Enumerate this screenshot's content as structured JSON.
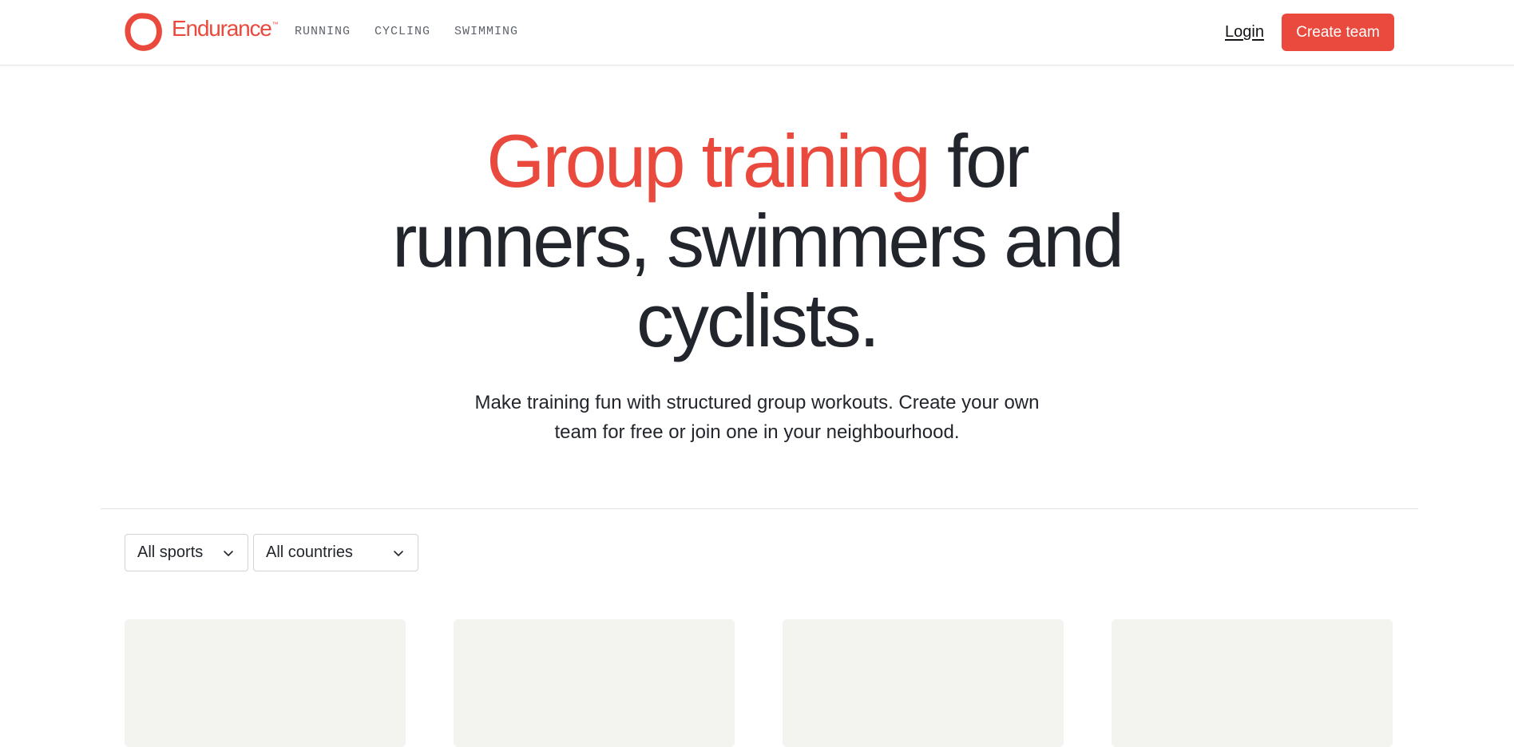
{
  "brand": {
    "name": "Endurance",
    "trademark": "™",
    "color": "#ea4a3d"
  },
  "nav": {
    "items": [
      {
        "label": "RUNNING"
      },
      {
        "label": "CYCLING"
      },
      {
        "label": "SWIMMING"
      }
    ]
  },
  "header": {
    "login_label": "Login",
    "create_team_label": "Create team"
  },
  "hero": {
    "title_accent": "Group training",
    "title_rest_line1": " for",
    "title_line2": "runners, swimmers and",
    "title_line3": "cyclists.",
    "subtitle_line1": "Make training fun with structured group workouts. Create your own",
    "subtitle_line2": "team for free or join one in your neighbourhood."
  },
  "filters": {
    "sport": {
      "selected": "All sports",
      "icon": "chevron-down-icon"
    },
    "country": {
      "selected": "All countries",
      "icon": "chevron-down-icon"
    }
  },
  "cards": [
    {
      "state": "loading"
    },
    {
      "state": "loading"
    },
    {
      "state": "loading"
    },
    {
      "state": "loading"
    }
  ],
  "colors": {
    "accent": "#ea4a3d",
    "text": "#22262c",
    "card_placeholder": "#f3f3ef"
  }
}
